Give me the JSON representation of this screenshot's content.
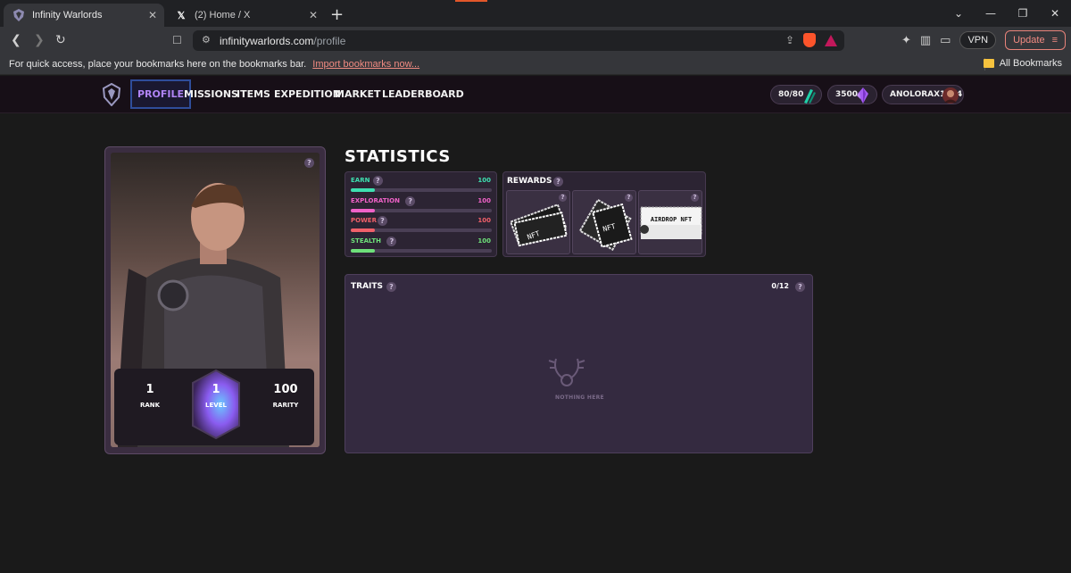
{
  "browser": {
    "tabs": [
      {
        "title": "Infinity Warlords",
        "active": true
      },
      {
        "title": "(2) Home / X",
        "active": false
      }
    ],
    "new_tab": "+",
    "url_host": "infinitywarlords.com",
    "url_path": "/profile",
    "vpn_label": "VPN",
    "update_label": "Update",
    "bookmarks_text": "For quick access, place your bookmarks here on the bookmarks bar.",
    "bookmarks_link": "Import bookmarks now...",
    "all_bookmarks": "All Bookmarks"
  },
  "app_nav": {
    "items": [
      "PROFILE",
      "MISSIONS",
      "ITEMS",
      "EXPEDITION",
      "MARKET",
      "LEADERBOARD"
    ],
    "active": "PROFILE",
    "energy": "80/80",
    "gems": "3500",
    "username": "ANOLORAX1264"
  },
  "card": {
    "rank_value": "1",
    "rank_label": "RANK",
    "level_value": "1",
    "level_label": "LEVEL",
    "rarity_value": "100",
    "rarity_label": "RARITY"
  },
  "statistics": {
    "title": "STATISTICS",
    "rows": [
      {
        "label": "EARN",
        "value": "100",
        "color": "#3ee0b0",
        "fill": 0.17
      },
      {
        "label": "EXPLORATION",
        "value": "100",
        "color": "#f062c8",
        "fill": 0.17
      },
      {
        "label": "POWER",
        "value": "100",
        "color": "#f0606a",
        "fill": 0.17
      },
      {
        "label": "STEALTH",
        "value": "100",
        "color": "#6ee07a",
        "fill": 0.17
      }
    ]
  },
  "rewards": {
    "title": "REWARDS",
    "ticket_texts": [
      "NFT",
      "NFT",
      "AIRDROP NFT"
    ]
  },
  "traits": {
    "title": "TRAITS",
    "count": "0/12",
    "empty_text": "NOTHING HERE"
  },
  "colors": {
    "accent": "#b084f5",
    "level_glow": "#6ac8ff"
  }
}
